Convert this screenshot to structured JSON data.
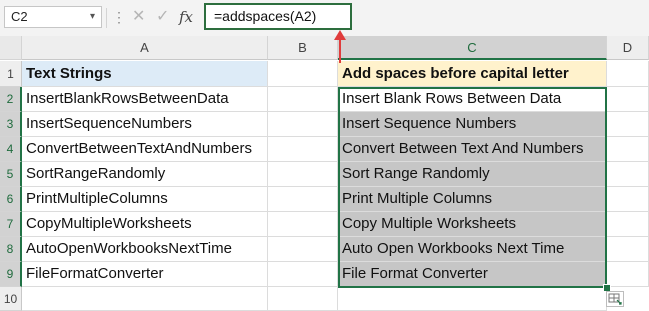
{
  "name_box": {
    "value": "C2"
  },
  "formula_bar": {
    "formula": "=addspaces(A2)"
  },
  "columns": [
    "A",
    "B",
    "C",
    "D"
  ],
  "rows": [
    "1",
    "2",
    "3",
    "4",
    "5",
    "6",
    "7",
    "8",
    "9",
    "10"
  ],
  "headers": {
    "a1": "Text Strings",
    "c1": "Add spaces before capital letter"
  },
  "column_a": [
    "InsertBlankRowsBetweenData",
    "InsertSequenceNumbers",
    "ConvertBetweenTextAndNumbers",
    "SortRangeRandomly",
    "PrintMultipleColumns",
    "CopyMultipleWorksheets",
    "AutoOpenWorkbooksNextTime",
    "FileFormatConverter"
  ],
  "column_c": [
    "Insert Blank Rows Between Data",
    "Insert Sequence Numbers",
    "Convert Between Text And Numbers",
    "Sort Range Randomly",
    "Print Multiple Columns",
    "Copy Multiple Worksheets",
    "Auto Open Workbooks Next Time",
    "File Format Converter"
  ],
  "icons": {
    "name_box_dropdown": "chevron-down-icon",
    "more": "vertical-dots-icon",
    "cancel": "close-icon",
    "enter": "check-icon",
    "function": "fx-icon",
    "annotation": "red-up-arrow-icon",
    "quick_analysis": "quick-analysis-icon"
  },
  "colors": {
    "header_a_fill": "#ddebf7",
    "header_c_fill": "#fff2cc",
    "selection_fill": "#c6c6c6",
    "selection_border": "#217346",
    "arrow": "#e03c3c"
  }
}
